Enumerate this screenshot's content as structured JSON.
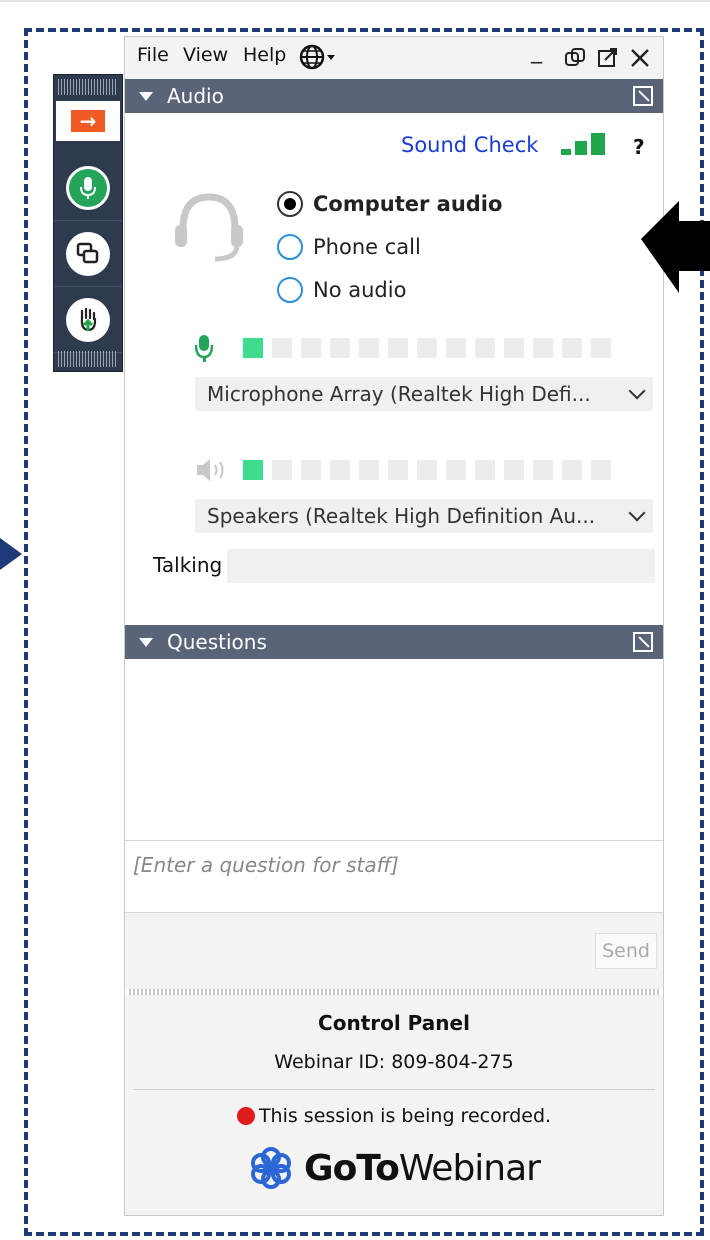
{
  "menubar": {
    "file": "File",
    "view": "View",
    "help": "Help"
  },
  "audio": {
    "header": "Audio",
    "sound_check": "Sound Check",
    "help_symbol": "?",
    "options": [
      {
        "label": "Computer audio",
        "selected": true
      },
      {
        "label": "Phone call",
        "selected": false
      },
      {
        "label": "No audio",
        "selected": false
      }
    ],
    "mic_level_on": 1,
    "mic_level_total": 13,
    "speaker_level_on": 1,
    "speaker_level_total": 13,
    "microphone_device": "Microphone Array (Realtek High Defi...",
    "speaker_device": "Speakers (Realtek High Definition Au...",
    "talking_label": "Talking"
  },
  "questions": {
    "header": "Questions",
    "placeholder": "[Enter a question for staff]",
    "send_label": "Send"
  },
  "control_panel": {
    "title": "Control Panel",
    "webinar_id": "Webinar ID: 809-804-275",
    "recording_notice": "This session is being recorded.",
    "brand_go": "GoTo",
    "brand_webinar": "Webinar"
  },
  "colors": {
    "frame": "#1f3a78",
    "header_bg": "#5a6478",
    "link_blue": "#1a3cd6",
    "level_green": "#3fdc8e",
    "record_red": "#e01b1b",
    "share_orange": "#f15a24"
  }
}
